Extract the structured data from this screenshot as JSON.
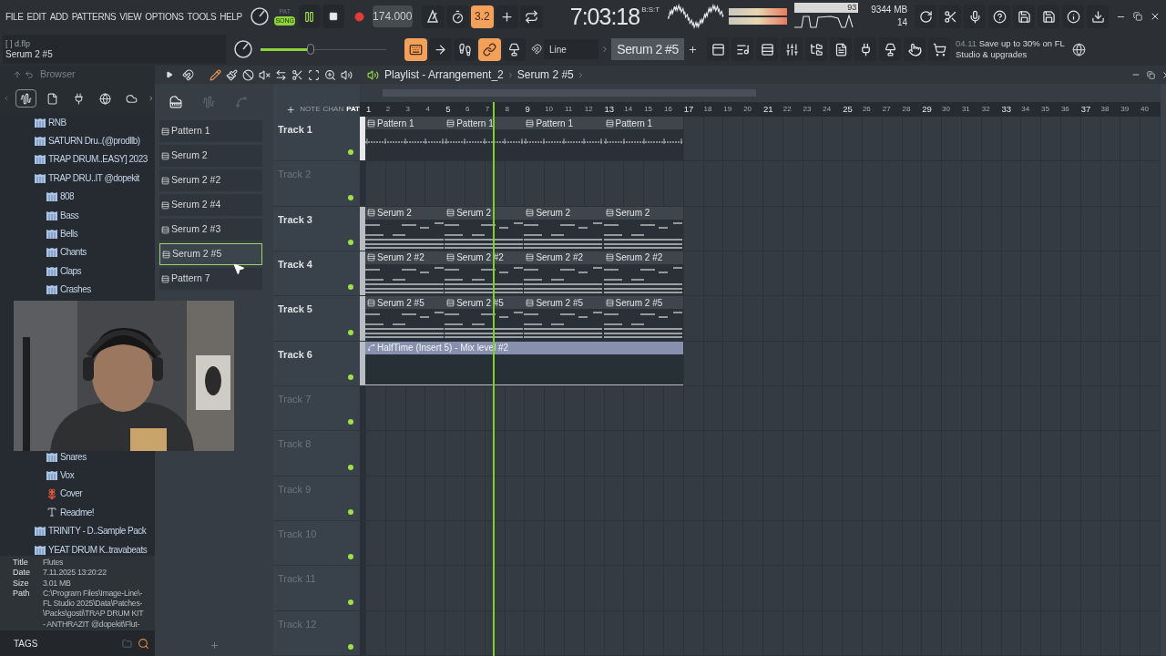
{
  "menu": [
    "FILE",
    "EDIT",
    "ADD",
    "PATTERNS",
    "VIEW",
    "OPTIONS",
    "TOOLS",
    "HELP"
  ],
  "file_info": {
    "name": "[ ] d.flp",
    "hint": "Serum 2 #5"
  },
  "transport": {
    "modes": [
      {
        "label": "PAT",
        "selected": false
      },
      {
        "label": "SONG",
        "selected": true
      }
    ],
    "playing": true,
    "tempo": "174.000"
  },
  "master_volume": {
    "level": 0.4
  },
  "record_toggles": [
    {
      "kind": "metronome",
      "on": false
    },
    {
      "kind": "wait",
      "on": false
    },
    {
      "kind": "countdown",
      "label": "3.2",
      "on": true
    },
    {
      "kind": "step",
      "on": false
    },
    {
      "kind": "loop",
      "on": false
    }
  ],
  "edit_toggles": [
    {
      "kind": "typing",
      "on": true
    },
    {
      "kind": "arrow",
      "on": false
    },
    {
      "kind": "step_edit",
      "on": false
    },
    {
      "kind": "link",
      "on": true
    },
    {
      "kind": "blend",
      "on": false
    }
  ],
  "time": {
    "value": "7:03:18",
    "unit": "B:S:T"
  },
  "cpu": "93",
  "memory": "9344 MB",
  "polyphony": "14",
  "snap": "Line",
  "pattern_selector": "Serum 2 #5",
  "news": {
    "date": "04.11",
    "text": "Save up to 30% on FL Studio & upgrades"
  },
  "browser": {
    "title": "Browser",
    "tabs": [
      {
        "kind": "all",
        "selected": true
      },
      {
        "kind": "files",
        "selected": false
      },
      {
        "kind": "plugins",
        "selected": false
      },
      {
        "kind": "online",
        "selected": false
      },
      {
        "kind": "cloud",
        "selected": false
      }
    ],
    "tree": [
      {
        "label": "RNB",
        "kind": "folder"
      },
      {
        "label": "SATURN Dru..(@prodllb)",
        "kind": "folder"
      },
      {
        "label": "TRAP DRUM..EASY] 2023",
        "kind": "folder"
      },
      {
        "label": "TRAP DRU..IT @dopekit",
        "kind": "folder",
        "children": [
          {
            "label": "808",
            "kind": "folder"
          },
          {
            "label": "Bass",
            "kind": "folder"
          },
          {
            "label": "Bells",
            "kind": "folder"
          },
          {
            "label": "Chants",
            "kind": "folder"
          },
          {
            "label": "Claps",
            "kind": "folder"
          },
          {
            "label": "Crashes",
            "kind": "folder"
          },
          {
            "label": "Snares",
            "kind": "folder"
          },
          {
            "label": "Vox",
            "kind": "folder"
          },
          {
            "label": "Cover"
          },
          {
            "label": "Readme!",
            "kind": "text"
          }
        ]
      },
      {
        "label": "TRINITY - D..Sample Pack",
        "kind": "folder"
      },
      {
        "label": "YEAT DRUM K..travabeats",
        "kind": "folder"
      }
    ],
    "info": [
      {
        "key": "Title",
        "lines": [
          "Flutes"
        ]
      },
      {
        "key": "Date",
        "lines": [
          "7.11.2025 13:20:22"
        ]
      },
      {
        "key": "Size",
        "lines": [
          "3.01 MB"
        ]
      },
      {
        "key": "Path",
        "lines": [
          "C:\\Program Files\\Image-Line\\-",
          "FL Studio 2025\\Data\\Patches-",
          "\\Packs\\gosti\\TRAP DRUM KIT",
          "- ANTHRAZIT @dopekit\\Flut-"
        ]
      }
    ],
    "tags": "TAGS"
  },
  "pattern_list": [
    {
      "label": "Pattern 1",
      "selected": false
    },
    {
      "label": "Serum 2",
      "selected": false
    },
    {
      "label": "Serum 2 #2",
      "selected": false
    },
    {
      "label": "Serum 2 #4",
      "selected": false
    },
    {
      "label": "Serum 2 #3",
      "selected": false
    },
    {
      "label": "Serum 2 #5",
      "selected": true
    },
    {
      "label": "Pattern 7",
      "selected": false
    }
  ],
  "playlist": {
    "title": "Playlist - Arrangement_2",
    "crumb": "Serum 2 #5",
    "header_labels": [
      {
        "label": "NOTE",
        "selected": false
      },
      {
        "label": "CHAN",
        "selected": false
      },
      {
        "label": "PAT",
        "selected": true
      }
    ],
    "ruler": [
      "1",
      "2",
      "3",
      "4",
      "5",
      "6",
      "7",
      "8",
      "9",
      "10",
      "11",
      "12",
      "13",
      "14",
      "15",
      "16",
      "17",
      "18",
      "19",
      "20",
      "21",
      "22",
      "23",
      "24",
      "25",
      "26",
      "27",
      "28",
      "29",
      "30",
      "31",
      "32",
      "33",
      "34",
      "35",
      "36",
      "37",
      "38",
      "39",
      "40"
    ],
    "playhead": {
      "level": 0.159
    },
    "tracks": [
      {
        "name": "Track 1",
        "selected": true,
        "enabled": true,
        "clips": [
          {
            "label": "Pattern 1",
            "kind": "pattern"
          },
          {
            "label": "Pattern 1",
            "kind": "pattern"
          },
          {
            "label": "Pattern 1",
            "kind": "pattern"
          },
          {
            "label": "Pattern 1",
            "kind": "pattern"
          }
        ]
      },
      {
        "name": "Track 2",
        "selected": false,
        "enabled": true
      },
      {
        "name": "Track 3",
        "selected": false,
        "enabled": true,
        "clips": [
          {
            "label": "Serum 2",
            "kind": "pattern"
          },
          {
            "label": "Serum 2",
            "kind": "pattern"
          },
          {
            "label": "Serum 2",
            "kind": "pattern"
          },
          {
            "label": "Serum 2",
            "kind": "pattern"
          }
        ]
      },
      {
        "name": "Track 4",
        "selected": false,
        "enabled": true,
        "clips": [
          {
            "label": "Serum 2 #2",
            "kind": "pattern"
          },
          {
            "label": "Serum 2 #2",
            "kind": "pattern"
          },
          {
            "label": "Serum 2 #2",
            "kind": "pattern"
          },
          {
            "label": "Serum 2 #2",
            "kind": "pattern"
          }
        ]
      },
      {
        "name": "Track 5",
        "selected": false,
        "enabled": true,
        "clips": [
          {
            "label": "Serum 2 #5",
            "kind": "pattern"
          },
          {
            "label": "Serum 2 #5",
            "kind": "pattern"
          },
          {
            "label": "Serum 2 #5",
            "kind": "pattern"
          },
          {
            "label": "Serum 2 #5",
            "kind": "pattern"
          }
        ]
      },
      {
        "name": "Track 6",
        "selected": false,
        "enabled": true,
        "clips": [
          {
            "label": "HalfTime (Insert 5) - Mix level #2",
            "kind": "automation"
          }
        ]
      },
      {
        "name": "Track 7",
        "selected": false,
        "enabled": true
      },
      {
        "name": "Track 8",
        "selected": false,
        "enabled": true
      },
      {
        "name": "Track 9",
        "selected": false,
        "enabled": true
      },
      {
        "name": "Track 10",
        "selected": false,
        "enabled": true
      },
      {
        "name": "Track 11",
        "selected": false,
        "enabled": true
      },
      {
        "name": "Track 12",
        "selected": false,
        "enabled": true
      }
    ]
  }
}
